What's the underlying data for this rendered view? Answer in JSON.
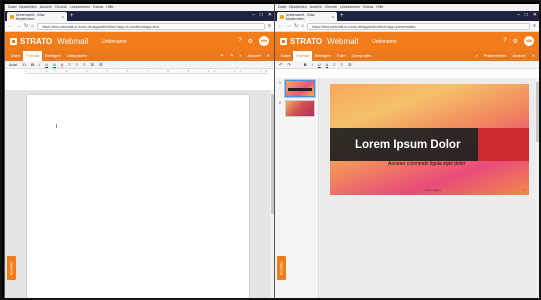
{
  "browser": {
    "menu": [
      "Datei",
      "Bearbeiten",
      "Ansicht",
      "Chronik",
      "Lesezeichen",
      "Extras",
      "Hilfe"
    ],
    "window_controls": [
      "–",
      "□",
      "✕"
    ]
  },
  "left": {
    "tab_title": "Unbenannt - Mac Modernism",
    "url": "https://test-webmail.ui.ionos.de/appsuite/office?app=io.ox/office&app=text",
    "brand": "STRATO",
    "product": "Webmail",
    "doc_title": "Unbenannt",
    "avatar": "MM",
    "tabs": [
      "Datei",
      "Format",
      "Einfügen",
      "Überprüfen"
    ],
    "active_tab": "Format",
    "view_label": "Ansicht",
    "toolbar": [
      "Arial",
      "11",
      "B",
      "I",
      "U",
      "A",
      "A",
      "≡",
      "≡",
      "≡",
      "☰",
      "☰"
    ],
    "ruler": "1 · 2 · 3 · 4 · 5 · 6 · 7 · 8 · 9 · 10 · 11 · 12 · 13 · 14 · 15 · 16 · 17",
    "side_tab": "Kontakte"
  },
  "right": {
    "tab_title": "Unbenannt - Mac Modernism",
    "url": "https://test-webmail.ui.ionos.de/appsuite/office?app=presentation",
    "brand": "STRATO",
    "product": "Webmail",
    "doc_title": "Unbenannt",
    "avatar": "MM",
    "tabs": [
      "Datei",
      "Format",
      "Einfügen",
      "Folie",
      "Überprüfen"
    ],
    "active_tab": "Format",
    "present_label": "Präsentieren",
    "view_label": "Ansicht",
    "toolbar": [
      "↶",
      "↷",
      "B",
      "I",
      "U",
      "A",
      "≡",
      "≡",
      "☰"
    ],
    "slide_numbers": [
      "1",
      "2"
    ],
    "slide_title": "Lorem Ipsum Dolor",
    "slide_subtitle": "Aenean commodo ligula eget dolor",
    "slide_footer": "Lorem ipsum",
    "slide_page": "1",
    "side_tab": "Kontakte"
  },
  "colors": {
    "brand_orange": "#f27b1a",
    "titlebar": "#202340",
    "slide_red": "#cd2c2c"
  }
}
